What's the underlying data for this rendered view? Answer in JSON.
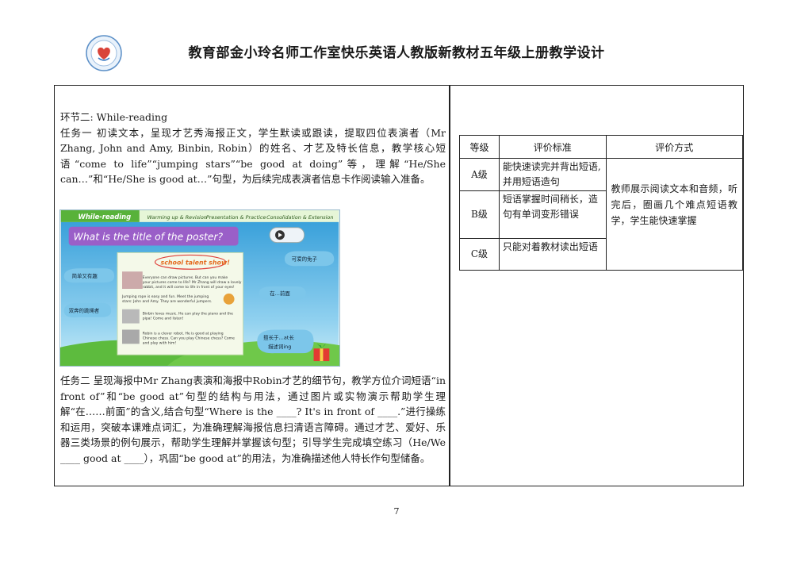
{
  "header": {
    "title": "教育部金小玲名师工作室快乐英语人教版新教材五年级上册教学设计"
  },
  "left": {
    "section": "环节二: While-reading",
    "task1": "任务一  初读文本，呈现才艺秀海报正文，学生默读或跟读，提取四位表演者（Mr Zhang, John and Amy, Binbin, Robin）的姓名、才艺及特长信息，教学核心短语“come to life”“jumping stars”“be good at doing”等，理解“He/She can…”和“He/She is good at…”句型，为后续完成表演者信息卡作阅读输入准备。",
    "task2": "任务二 呈现海报中Mr Zhang表演和海报中Robin才艺的细节句，教学方位介词短语“in front of”和“be good at”句型的结构与用法，通过图片或实物演示帮助学生理解“在……前面”的含义,结合句型“Where is the ____? It's in front of ____.”进行操练和运用，突破本课难点词汇，为准确理解海报信息扫清语言障碍。通过才艺、爱好、乐器三类场景的例句展示，帮助学生理解并掌握该句型；引导学生完成填空练习（He/We ____ good at ____），巩固“be good at”的用法，为准确描述他人特长作句型储备。"
  },
  "slide": {
    "nav": [
      "While-reading",
      "Warming up & Revision",
      "Presentation & Practice",
      "Consolidation & Extension"
    ],
    "question": "What is the title of the poster?",
    "poster_heading": "school talent show!",
    "poster_lines": [
      "Everyone can draw pictures. But can you make",
      "your pictures come to life? Mr Zhang will draw a lovely",
      "rabbit, and it will come to life in front of your eyes!",
      "Jumping rope is easy and fun. Meet the jumping",
      "stars: John and Amy. They are wonderful jumpers.",
      "Binbin loves music. He can play the piano and the",
      "pipa! Come and listen!",
      "Robin is a clever robot. He is good at playing",
      "Chinese chess. Can you play Chinese chess? Come",
      "and play with him!"
    ],
    "bubbles": [
      "简单又有趣",
      "可爱的兔子",
      "在…前面",
      "双奔的跳绳者",
      "擅长于…at长",
      "描述词ing"
    ]
  },
  "rubric": {
    "headers": [
      "等级",
      "评价标准",
      "评价方式"
    ],
    "rows": [
      {
        "level": "A级",
        "criteria": "能快速读完并背出短语,并用短语造句"
      },
      {
        "level": "B级",
        "criteria": "短语掌握时间稍长，造句有单词变形错误"
      },
      {
        "level": "C级",
        "criteria": "只能对着教材读出短语"
      }
    ],
    "method": "教师展示阅读文本和音频，听完后，圈画几个难点短语教学，学生能快速掌握"
  },
  "footer": {
    "page_number": "7"
  }
}
